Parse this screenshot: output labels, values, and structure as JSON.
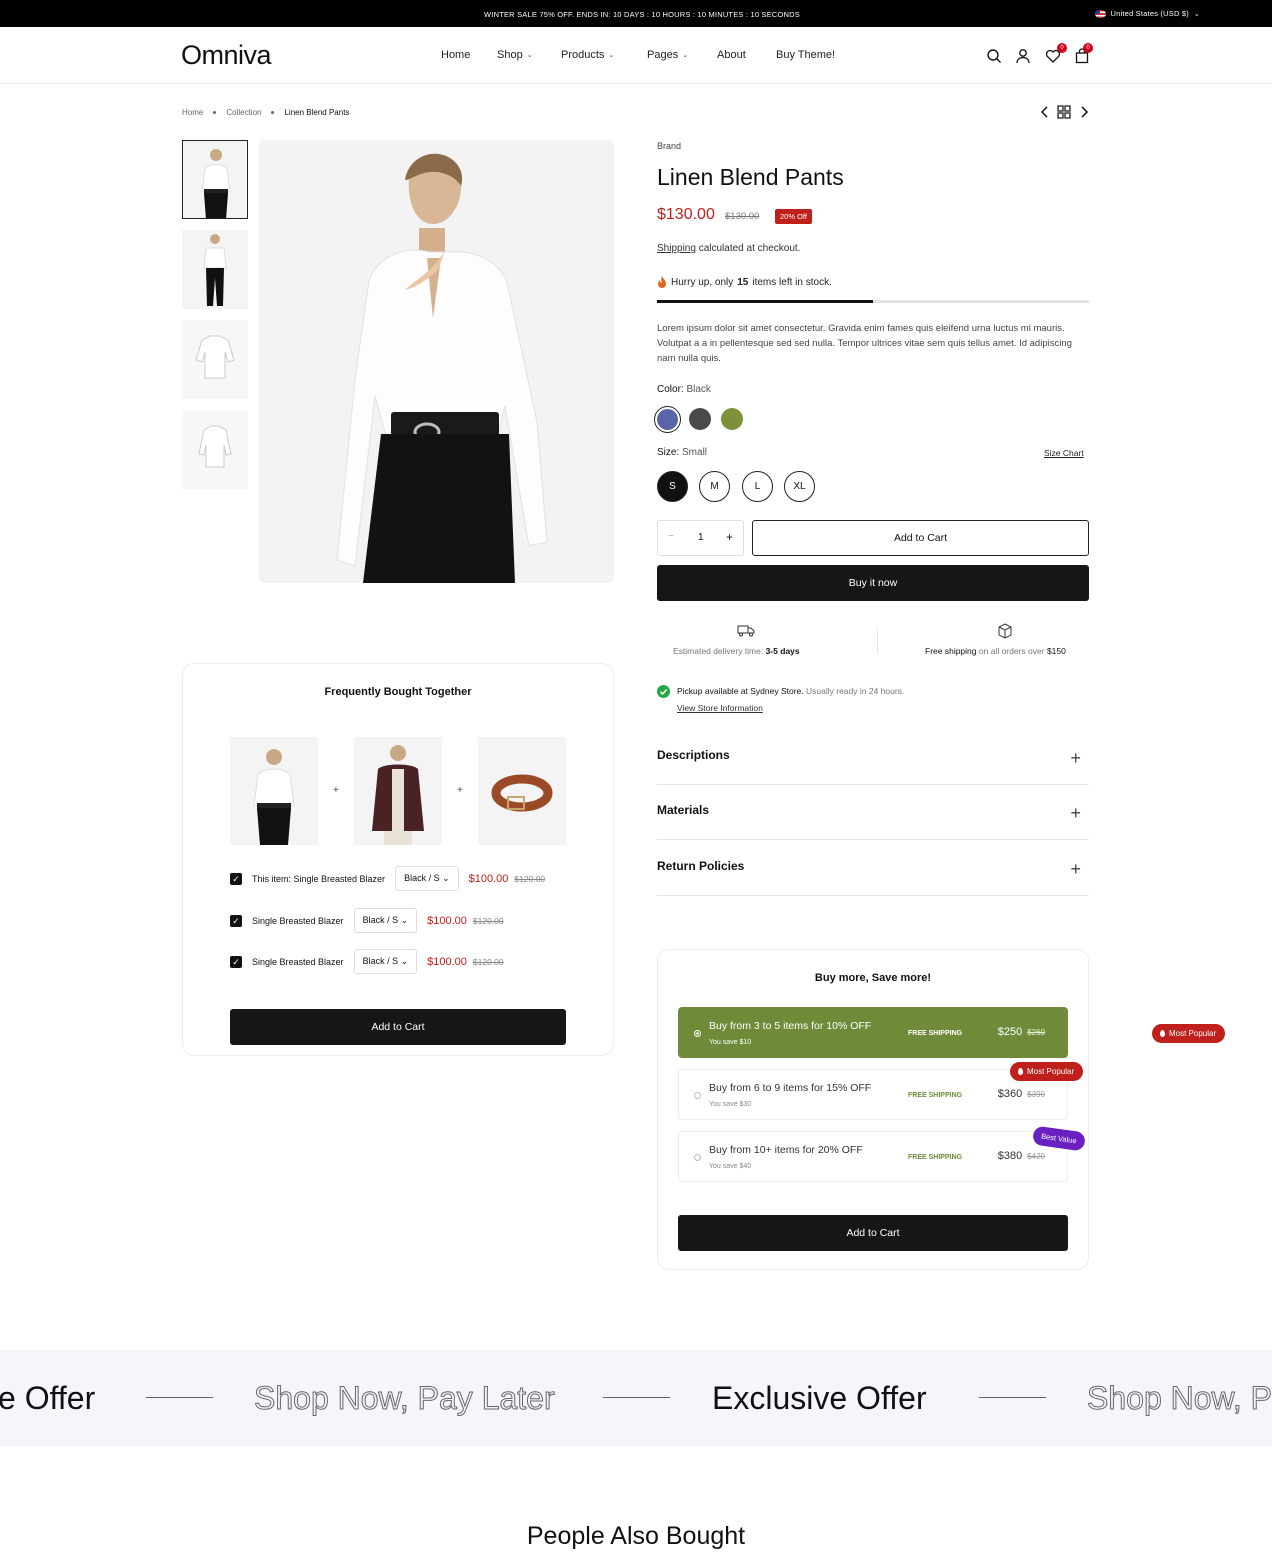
{
  "announcement": {
    "text": "WINTER SALE 75% OFF. ENDS IN: 10 DAYS : 10 HOURS : 10 MINUTES : 10 SECONDS",
    "currency": "United States (USD $)"
  },
  "header": {
    "logo": "Omniva",
    "nav": [
      {
        "label": "Home"
      },
      {
        "label": "Shop"
      },
      {
        "label": "Products"
      },
      {
        "label": "Pages"
      },
      {
        "label": "About"
      },
      {
        "label": "Buy Theme!"
      }
    ],
    "wishlist_count": "0",
    "cart_count": "0"
  },
  "breadcrumb": {
    "items": [
      "Home",
      "Collection",
      "Linen Blend Pants"
    ]
  },
  "product": {
    "brand": "Brand",
    "title": "Linen Blend Pants",
    "price": "$130.00",
    "compare_price": "$130.00",
    "discount_badge": "20% Off",
    "shipping_link": "Shipping",
    "shipping_text": "calculated at checkout.",
    "stock_pre": "Hurry up, only",
    "stock_count": "15",
    "stock_post": "items left in stock.",
    "stock_level": 0.5,
    "description": "Lorem ipsum dolor sit amet consectetur. Gravida enim fames quis eleifend urna luctus mi mauris. Volutpat a a in pellentesque sed sed nulla. Tempor ultrices vitae sem quis tellus amet. Id adipiscing nam nulla quis.",
    "color_label": "Color:",
    "color_value": "Black",
    "colors": [
      "#5a64a8",
      "#4a4a4a",
      "#7c9139"
    ],
    "size_label": "Size:",
    "size_value": "Small",
    "size_chart": "Size Chart",
    "sizes": [
      "S",
      "M",
      "L",
      "XL"
    ],
    "quantity": "1",
    "qty_minus": "−",
    "qty_plus": "+",
    "add_to_cart": "Add to Cart",
    "buy_now": "Buy it now",
    "delivery_pre": "Estimated delivery time:",
    "delivery_days": "3-5 days",
    "free_ship_link": "Free shipping",
    "free_ship_mid": "on all orders over",
    "free_ship_amount": "$150",
    "pickup_bold": "Pickup available at Sydney Store.",
    "pickup_rest": "Usually ready in 24 hours.",
    "store_link": "View Store Information",
    "accordions": [
      "Descriptions",
      "Materials",
      "Return Policies"
    ]
  },
  "fbt": {
    "title": "Frequently Bought Together",
    "items": [
      {
        "name": "This item: Single Breasted Blazer",
        "variant": "Black / S",
        "price": "$100.00",
        "compare": "$120.00"
      },
      {
        "name": "Single Breasted Blazer",
        "variant": "Black / S",
        "price": "$100.00",
        "compare": "$120.00"
      },
      {
        "name": "Single Breasted Blazer",
        "variant": "Black / S",
        "price": "$100.00",
        "compare": "$120.00"
      }
    ],
    "add_to_cart": "Add to Cart"
  },
  "bundle": {
    "title": "Buy more, Save more!",
    "tiers": [
      {
        "label": "Buy from 3 to 5 items for 10% OFF",
        "save": "You save $10",
        "shipping": "FREE SHIPPING",
        "price": "$250",
        "compare": "$260"
      },
      {
        "label": "Buy from 6 to 9 items for 15% OFF",
        "save": "You save $30",
        "shipping": "FREE SHIPPING",
        "price": "$360",
        "compare": "$390"
      },
      {
        "label": "Buy from 10+ items for 20% OFF",
        "save": "You save $40",
        "shipping": "FREE SHIPPING",
        "price": "$380",
        "compare": "$420"
      }
    ],
    "most_popular": "Most Popular",
    "best_value": "Best Value",
    "add_to_cart": "Add to Cart"
  },
  "marquee": {
    "items": [
      "e Offer",
      "Shop Now, Pay Later",
      "Exclusive Offer",
      "Shop Now, P"
    ]
  },
  "people_also_bought": "People Also Bought",
  "colors": {
    "accent_red": "#c0201b",
    "tier_green": "#6f8b3a",
    "best_value_purple": "#6a1fc2"
  }
}
